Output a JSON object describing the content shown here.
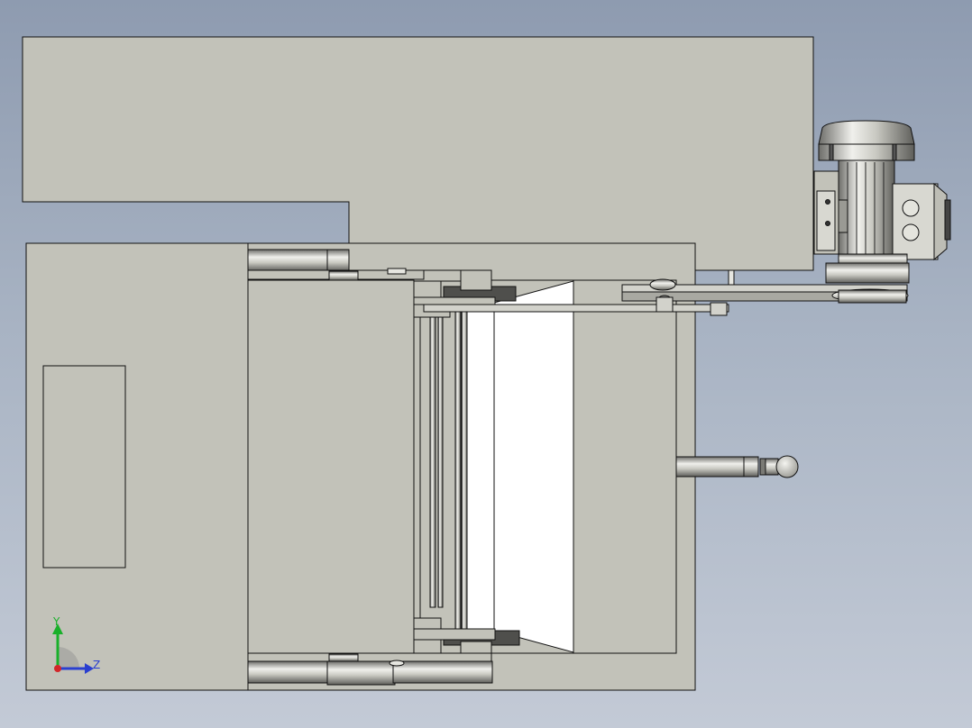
{
  "viewport": {
    "background_top": "#8e9bb0",
    "background_bottom": "#c3cad6",
    "part_fill": "#c2c2b9",
    "edge_color": "#111111",
    "metal_highlight": "#f0f0ec",
    "metal_shadow": "#6e6e6a"
  },
  "triad": {
    "y_label": "Y",
    "z_label": "Z",
    "y_color": "#19b02a",
    "z_color": "#2a3fd0",
    "x_color": "#d2262a"
  }
}
